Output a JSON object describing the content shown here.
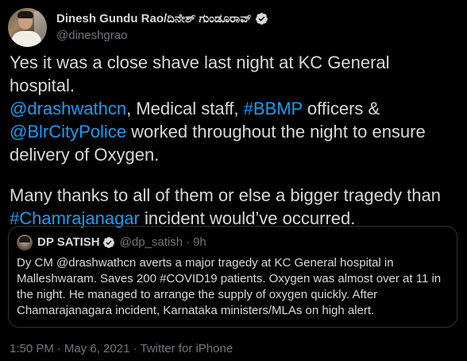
{
  "author": {
    "display_name": "Dinesh Gundu Rao/ದಿನೇಶ್ ಗುಂಡೂರಾವ್",
    "handle": "@dineshgrao",
    "verified_icon": "verified-badge-icon"
  },
  "tweet": {
    "paragraph1": {
      "t1": "Yes it was a close shave last night at KC General hospital.",
      "m1": "@drashwathcn",
      "t2": ", Medical staff, ",
      "h1": "#BBMP",
      "t3": " officers &",
      "m2": "@BlrCityPolice",
      "t4": " worked throughout the night to ensure delivery of Oxygen."
    },
    "paragraph2": {
      "t1": "Many thanks to all of them or else a bigger tragedy than",
      "h1": "#Chamrajanagar",
      "t2": " incident would’ve occurred."
    }
  },
  "quoted_tweet": {
    "display_name": "DP SATISH",
    "handle": "@dp_satish",
    "separator": "·",
    "time": "9h",
    "text": "Dy CM @drashwathcn averts a major tragedy at KC General hospital in Malleshwaram. Saves 200 #COVID19 patients. Oxygen was almost over at 11 in the night. He managed to arrange the supply of oxygen quickly. After Chamarajanagara incident, Karnataka ministers/MLAs on high alert."
  },
  "meta": {
    "time": "1:50 PM",
    "date": "May 6, 2021",
    "source": "Twitter for iPhone",
    "separator": "·"
  },
  "colors": {
    "background": "#000000",
    "text": "#d9d9d9",
    "secondary": "#6e767d",
    "link": "#1d9bf0",
    "border": "#2f3336"
  }
}
